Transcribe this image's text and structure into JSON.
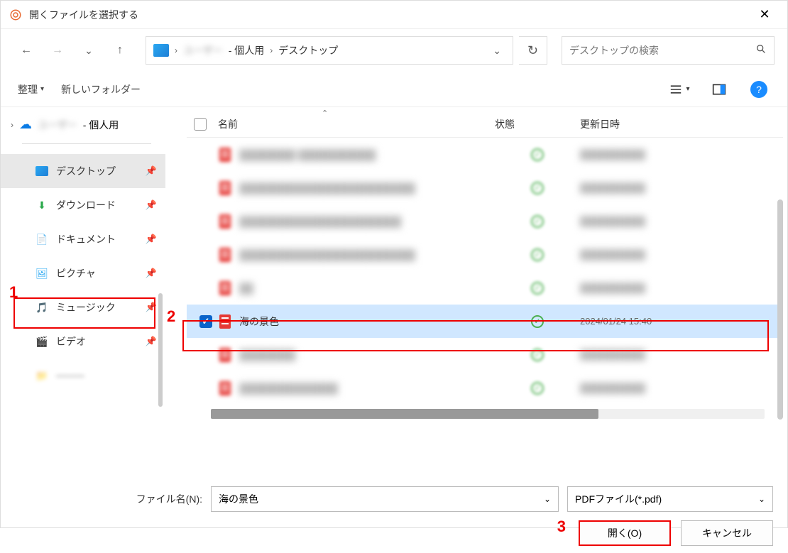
{
  "title": "開くファイルを選択する",
  "breadcrumb": {
    "hidden_user": "ユーザー",
    "personal": "- 個人用",
    "desktop": "デスクトップ"
  },
  "search": {
    "placeholder": "デスクトップの検索"
  },
  "toolbar": {
    "organize": "整理",
    "newfolder": "新しいフォルダー"
  },
  "side": {
    "top_personal": "- 個人用",
    "items": [
      {
        "label": "デスクトップ",
        "selected": true
      },
      {
        "label": "ダウンロード"
      },
      {
        "label": "ドキュメント"
      },
      {
        "label": "ピクチャ"
      },
      {
        "label": "ミュージック"
      },
      {
        "label": "ビデオ"
      }
    ]
  },
  "columns": {
    "name": "名前",
    "state": "状態",
    "date": "更新日時"
  },
  "selected_file": {
    "name": "海の景色",
    "date": "2024/01/24 15:40"
  },
  "footer": {
    "filename_label": "ファイル名(N):",
    "filename_value": "海の景色",
    "filter": "PDFファイル(*.pdf)",
    "open": "開く(O)",
    "cancel": "キャンセル"
  },
  "annotations": {
    "one": "1",
    "two": "2",
    "three": "3"
  }
}
